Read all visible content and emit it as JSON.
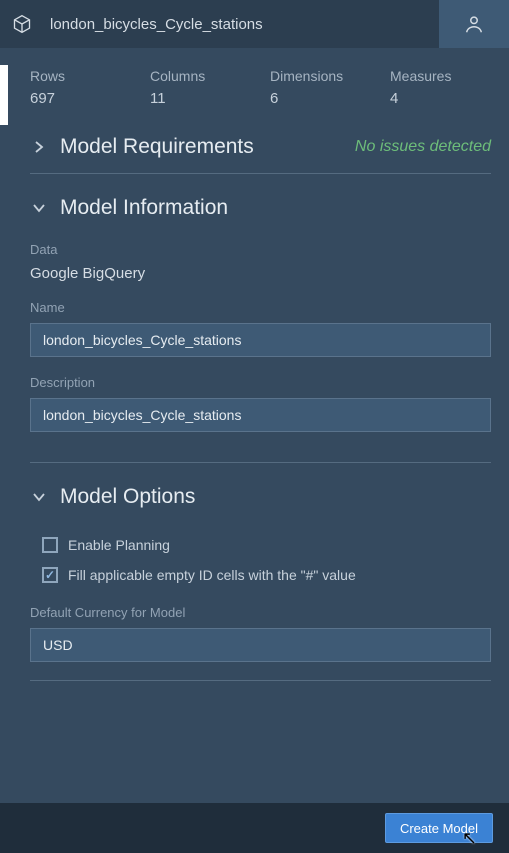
{
  "header": {
    "title": "london_bicycles_Cycle_stations"
  },
  "stats": {
    "rows_label": "Rows",
    "rows_value": "697",
    "columns_label": "Columns",
    "columns_value": "11",
    "dimensions_label": "Dimensions",
    "dimensions_value": "6",
    "measures_label": "Measures",
    "measures_value": "4"
  },
  "sections": {
    "requirements_title": "Model Requirements",
    "requirements_status": "No issues detected",
    "information_title": "Model Information",
    "options_title": "Model Options"
  },
  "info": {
    "data_label": "Data",
    "data_value": "Google BigQuery",
    "name_label": "Name",
    "name_value": "london_bicycles_Cycle_stations",
    "description_label": "Description",
    "description_value": "london_bicycles_Cycle_stations"
  },
  "options": {
    "enable_planning_label": "Enable Planning",
    "enable_planning_checked": false,
    "fill_empty_label": "Fill applicable empty ID cells with the \"#\" value",
    "fill_empty_checked": true,
    "currency_label": "Default Currency for Model",
    "currency_value": "USD"
  },
  "footer": {
    "create_label": "Create Model"
  }
}
